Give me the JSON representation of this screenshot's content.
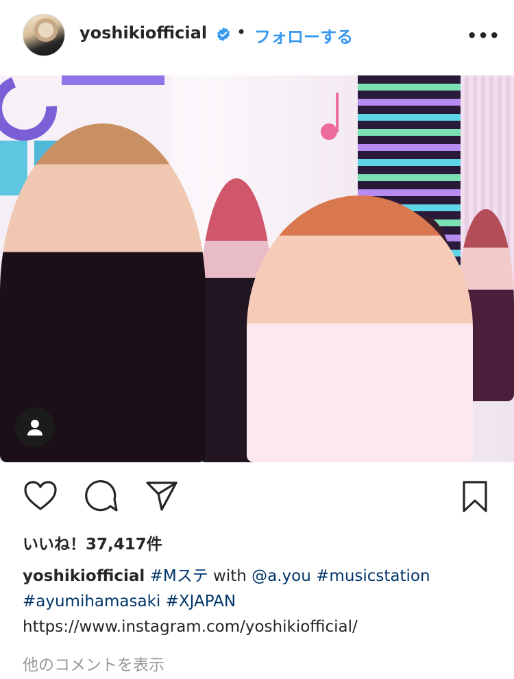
{
  "header": {
    "username": "yoshikiofficial",
    "separator": "•",
    "follow_label": "フォローする",
    "more_label": "•••",
    "avatar_icon": "profile-avatar",
    "verified_icon": "verified-badge-icon",
    "accent_color": "#3897f0"
  },
  "post": {
    "image_icon": "photo",
    "user_tag_icon": "person-icon"
  },
  "actions": {
    "like_icon": "heart-icon",
    "comment_icon": "comment-icon",
    "share_icon": "paper-plane-icon",
    "save_icon": "bookmark-icon"
  },
  "likes": {
    "text": "いいね！37,417件"
  },
  "caption": {
    "username": "yoshikiofficial",
    "tag_mste": "#Mステ",
    "with_text": "with",
    "mention": "@a.you",
    "tag_musicstation": "#musicstation",
    "tag_ayumi": "#ayumihamasaki",
    "tag_xjapan": "#XJAPAN",
    "link": "https://www.instagram.com/yoshikiofficial/"
  },
  "comments": {
    "view_label": "他のコメントを表示"
  }
}
